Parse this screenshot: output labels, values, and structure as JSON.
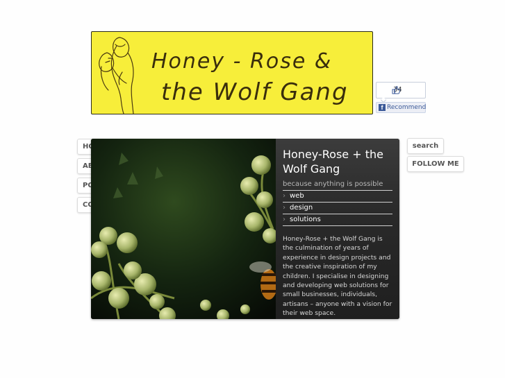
{
  "banner": {
    "logo_text_line1": "Honey - Rose &",
    "logo_text_line2": "the Wolf Gang",
    "background_color": "#f7ee3a"
  },
  "facebook": {
    "like_count": "34",
    "recommend_label": "Recommend",
    "f_glyph": "f",
    "thumb_icon": "thumbs-up-icon"
  },
  "nav": {
    "items": [
      {
        "label": "HOME"
      },
      {
        "label": "ABOUT"
      },
      {
        "label": "PORTFOLIO"
      },
      {
        "label": "CONTACT"
      }
    ]
  },
  "side": {
    "search_label": "search",
    "follow_label": "FOLLOW ME"
  },
  "slide": {
    "title": "Honey-Rose + the Wolf Gang",
    "tagline": "because anything is possible",
    "links": [
      "web",
      "design",
      "solutions"
    ],
    "description": "Honey-Rose + the Wolf Gang is the culmination of years of experience in design projects and the creative inspiration of my children. I specialise in designing and developing web solutions for small businesses, individuals, artisans – anyone with a vision for their web space."
  },
  "colors": {
    "panel_bg": "#2a2a2a",
    "fb_blue": "#3b5998"
  }
}
